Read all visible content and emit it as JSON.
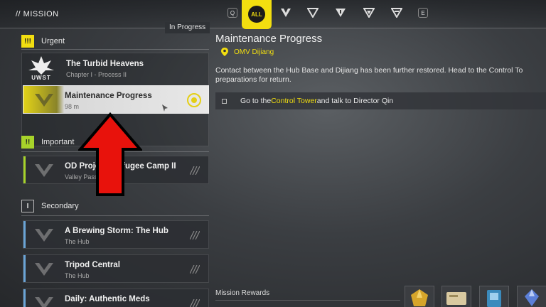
{
  "header": {
    "title": "// MISSION",
    "status_tab": "In Progress",
    "filters": [
      {
        "name": "search",
        "label": "Q"
      },
      {
        "name": "all",
        "label": "ALL",
        "selected": true
      },
      {
        "name": "urgent-filter",
        "label": ""
      },
      {
        "name": "important-filter",
        "label": ""
      },
      {
        "name": "secondary-filter",
        "label": ""
      },
      {
        "name": "misc-filter",
        "label": ""
      },
      {
        "name": "other-filter",
        "label": ""
      },
      {
        "name": "e-key",
        "label": "E"
      }
    ]
  },
  "categories": {
    "urgent": {
      "label": "Urgent",
      "badge": "!!!"
    },
    "important": {
      "label": "Important",
      "badge": "!!"
    },
    "secondary": {
      "label": "Secondary",
      "badge": "I"
    }
  },
  "urgent_chapter": {
    "logo_text": "UWST",
    "title": "The Turbid Heavens",
    "subtitle": "Chapter I - Process II"
  },
  "quests": [
    {
      "title": "Maintenance Progress",
      "subtitle": "98 m",
      "active": true
    },
    {
      "title": "OD Project: Refugee Camp II",
      "subtitle": "Valley Pass"
    },
    {
      "title": "A Brewing Storm: The Hub",
      "subtitle": "The Hub"
    },
    {
      "title": "Tripod Central",
      "subtitle": "The Hub"
    },
    {
      "title": "Daily: Authentic Meds",
      "subtitle": ""
    }
  ],
  "detail": {
    "title": "Maintenance Progress",
    "location": "OMV Dijiang",
    "description_line1": "Contact between the Hub Base and Dijiang has been further restored. Head to the Control To",
    "description_line2": "preparations for return.",
    "objective_prefix": "Go to the ",
    "objective_highlight": "Control Tower",
    "objective_suffix": " and talk to Director Qin",
    "rewards_label": "Mission Rewards"
  },
  "colors": {
    "accent_yellow": "#f2de10",
    "important_green": "#a7d32a",
    "secondary_blue": "#6aa4d6",
    "arrow_red": "#e8120c"
  }
}
